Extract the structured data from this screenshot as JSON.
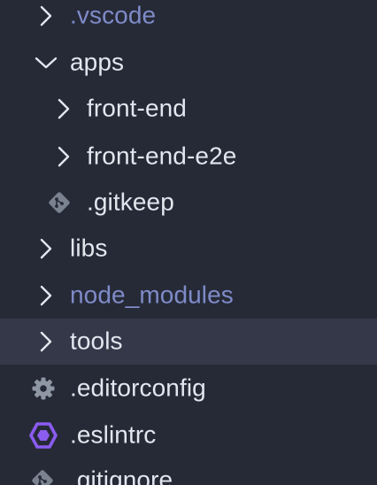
{
  "explorer": {
    "items": [
      {
        "label": ".vscode",
        "kind": "folder",
        "state": "collapsed",
        "icon": "chevron-right-icon",
        "dimmed": true,
        "selected": false
      },
      {
        "label": "apps",
        "kind": "folder",
        "state": "expanded",
        "icon": "chevron-down-icon",
        "dimmed": false,
        "selected": false
      },
      {
        "label": "front-end",
        "kind": "folder",
        "state": "collapsed",
        "icon": "chevron-right-icon",
        "dimmed": false,
        "selected": false
      },
      {
        "label": "front-end-e2e",
        "kind": "folder",
        "state": "collapsed",
        "icon": "chevron-right-icon",
        "dimmed": false,
        "selected": false
      },
      {
        "label": ".gitkeep",
        "kind": "file",
        "icon": "git-file-icon",
        "dimmed": false,
        "selected": false
      },
      {
        "label": "libs",
        "kind": "folder",
        "state": "collapsed",
        "icon": "chevron-right-icon",
        "dimmed": false,
        "selected": false
      },
      {
        "label": "node_modules",
        "kind": "folder",
        "state": "collapsed",
        "icon": "chevron-right-icon",
        "dimmed": true,
        "selected": false
      },
      {
        "label": "tools",
        "kind": "folder",
        "state": "collapsed",
        "icon": "chevron-right-icon",
        "dimmed": false,
        "selected": true
      },
      {
        "label": ".editorconfig",
        "kind": "file",
        "icon": "gear-icon",
        "dimmed": false,
        "selected": false
      },
      {
        "label": ".eslintrc",
        "kind": "file",
        "icon": "eslint-icon",
        "dimmed": false,
        "selected": false
      },
      {
        "label": ".gitignore",
        "kind": "file",
        "icon": "git-file-icon",
        "dimmed": false,
        "selected": false
      }
    ]
  },
  "colors": {
    "background": "#262a37",
    "selected_row": "#343849",
    "text": "#e3e6ee",
    "dimmed_text": "#7f8bc8",
    "chevron": "#e3e6ee",
    "git_icon": "#7a8290",
    "gear_icon": "#8f97a5",
    "eslint_icon": "#8b5cf0"
  }
}
